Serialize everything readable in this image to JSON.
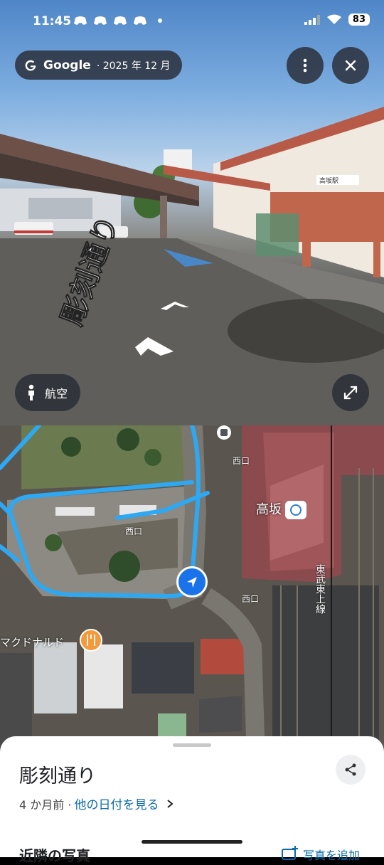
{
  "status_bar": {
    "time": "11:45",
    "battery": "83"
  },
  "viewer": {
    "brand": "Google",
    "capture_date": "· 2025 年 12 月",
    "aerial_label": "航空",
    "road_painted_text": "彫刻通り",
    "station_sign": "高坂駅"
  },
  "map": {
    "labels": {
      "west_exit_top": "西口",
      "west_exit_mid": "西口",
      "west_exit_side": "西口",
      "station": "高坂",
      "rail_line": "東武東上線",
      "mcdonalds": "マクドナルド"
    }
  },
  "sheet": {
    "title": "彫刻通り",
    "age": "4 か月前 ·",
    "other_dates": "他の日付を見る",
    "nearby_title": "近隣の写真",
    "add_photo": "写真を追加"
  },
  "colors": {
    "route": "#2ea8f2",
    "link": "#0b6ba8",
    "overlay": "#282c34"
  }
}
